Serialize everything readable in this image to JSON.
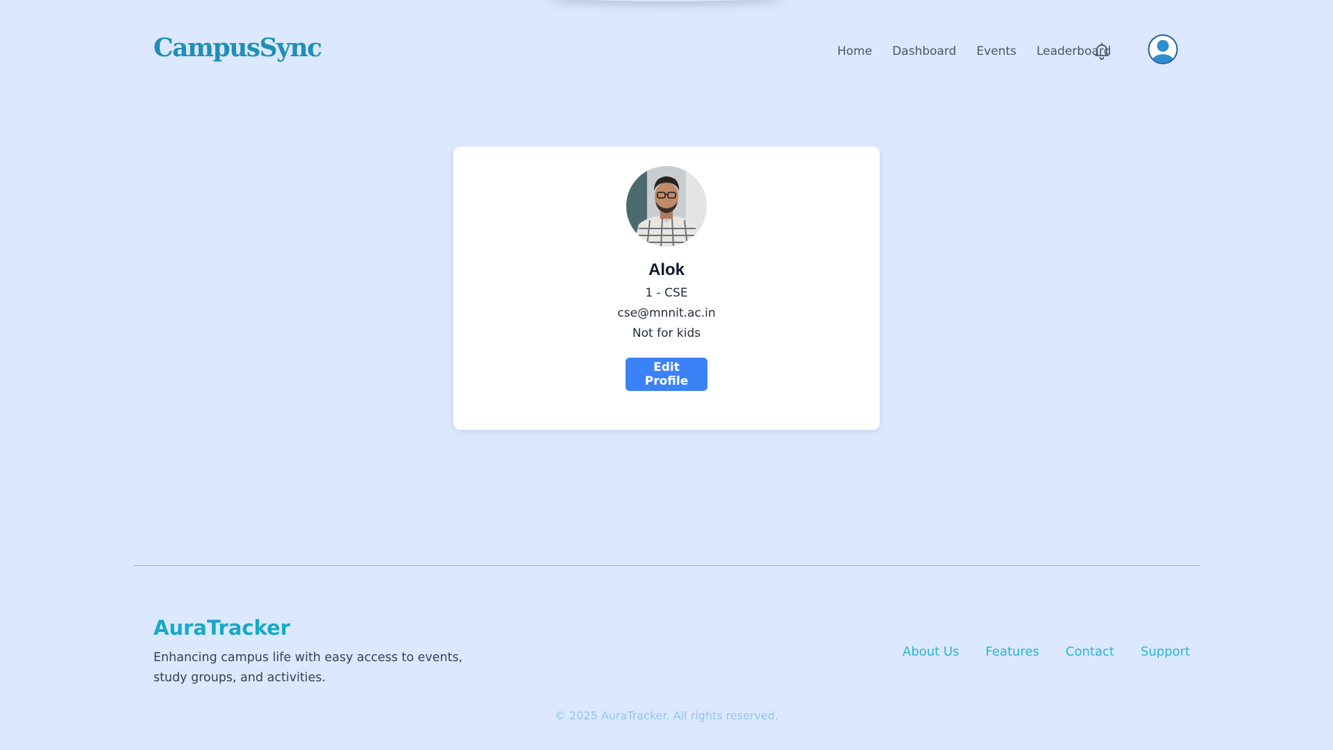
{
  "header": {
    "brand": "CampusSync",
    "nav": [
      "Home",
      "Dashboard",
      "Events",
      "Leaderboard"
    ],
    "icons": {
      "notifications": "bell-icon",
      "profile": "user-circle-icon"
    }
  },
  "profile": {
    "name": "Alok",
    "year_branch": "1 - CSE",
    "email": "cse@mnnit.ac.in",
    "bio": "Not for kids",
    "edit_button": "Edit Profile"
  },
  "footer": {
    "brand": "AuraTracker",
    "description": "Enhancing campus life with easy access to events, study groups, and activities.",
    "links": [
      "About Us",
      "Features",
      "Contact",
      "Support"
    ],
    "copyright": "© 2025 AuraTracker. All rights reserved."
  },
  "colors": {
    "background": "#dbe8fd",
    "brand": "#1f8fb8",
    "footer_brand": "#16a9c9",
    "button": "#3b82f6",
    "footer_link": "#28b3d3"
  }
}
